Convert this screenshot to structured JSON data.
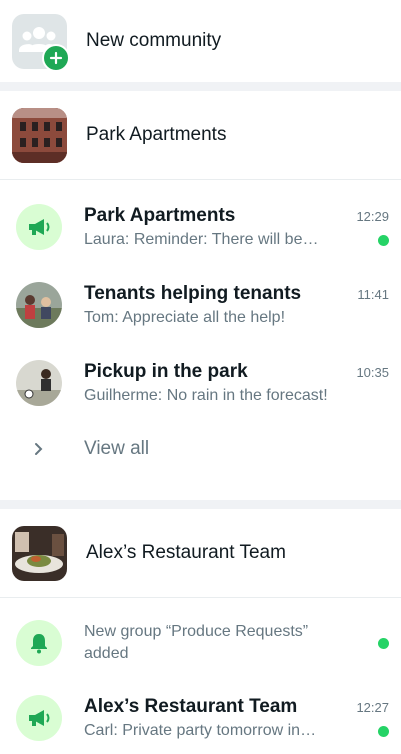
{
  "new_community": {
    "label": "New community",
    "icon": "community-add-icon"
  },
  "communities": [
    {
      "name": "Park Apartments",
      "chats": [
        {
          "name": "Park Apartments",
          "time": "12:29",
          "message": "Laura: Reminder: There will be…",
          "unread": true,
          "icon": "megaphone-icon"
        },
        {
          "name": "Tenants helping tenants",
          "time": "11:41",
          "message": "Tom: Appreciate all the help!",
          "unread": false
        },
        {
          "name": "Pickup in the park",
          "time": "10:35",
          "message": "Guilherme: No rain in the forecast!",
          "unread": false
        }
      ],
      "view_all": "View all"
    },
    {
      "name": "Alex’s Restaurant Team",
      "notice": {
        "message": "New group “Produce Requests” added",
        "unread": true,
        "icon": "bell-icon"
      },
      "chats": [
        {
          "name": "Alex’s Restaurant Team",
          "time": "12:27",
          "message": "Carl: Private party tomorrow in…",
          "unread": true,
          "icon": "megaphone-icon"
        }
      ]
    }
  ],
  "colors": {
    "accent": "#25d366",
    "icon_green": "#1fa855",
    "icon_bg": "#d9fdd3"
  }
}
